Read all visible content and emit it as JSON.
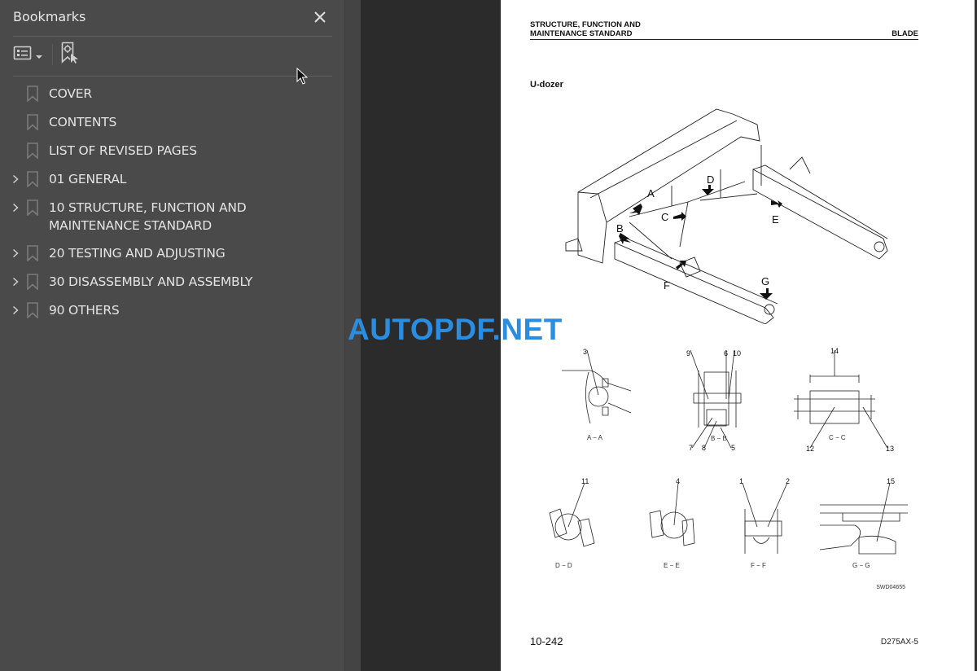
{
  "sidebar": {
    "title": "Bookmarks",
    "close_icon": "close-icon",
    "toolbar": {
      "options_icon": "list-options-icon",
      "options_dropdown_icon": "caret-down-icon",
      "find_current_icon": "bookmark-find-current-icon"
    },
    "items": [
      {
        "label": "COVER",
        "expandable": false
      },
      {
        "label": "CONTENTS",
        "expandable": false
      },
      {
        "label": "LIST OF REVISED PAGES",
        "expandable": false
      },
      {
        "label": "01 GENERAL",
        "expandable": true
      },
      {
        "label": "10 STRUCTURE, FUNCTION AND MAINTENANCE STANDARD",
        "expandable": true
      },
      {
        "label": "20 TESTING AND ADJUSTING",
        "expandable": true
      },
      {
        "label": "30 DISASSEMBLY AND ASSEMBLY",
        "expandable": true
      },
      {
        "label": "90 OTHERS",
        "expandable": true
      }
    ]
  },
  "page": {
    "header_left_line1": "STRUCTURE, FUNCTION AND",
    "header_left_line2": "MAINTENANCE STANDARD",
    "header_right": "BLADE",
    "section_title": "U-dozer",
    "main_figure_callouts": [
      "A",
      "B",
      "C",
      "D",
      "E",
      "F",
      "G"
    ],
    "details": [
      {
        "caption": "A − A",
        "numbers": [
          "3"
        ]
      },
      {
        "caption": "B − B",
        "numbers": [
          "9",
          "6",
          "10",
          "7",
          "8",
          "5"
        ]
      },
      {
        "caption": "C − C",
        "numbers": [
          "14",
          "12",
          "13"
        ]
      },
      {
        "caption": "D − D",
        "numbers": [
          "11"
        ]
      },
      {
        "caption": "E − E",
        "numbers": [
          "4"
        ]
      },
      {
        "caption": "F − F",
        "numbers": [
          "1",
          "2"
        ]
      },
      {
        "caption": "G − G",
        "numbers": [
          "15"
        ]
      }
    ],
    "figure_code": "SWD04655",
    "page_number": "10-242",
    "model": "D275AX-5"
  },
  "watermark": "AUTOPDF.NET",
  "colors": {
    "sidebar_bg": "#4a4a4a",
    "viewport_bg": "#2b2b2b",
    "watermark": "#2a8de0"
  }
}
